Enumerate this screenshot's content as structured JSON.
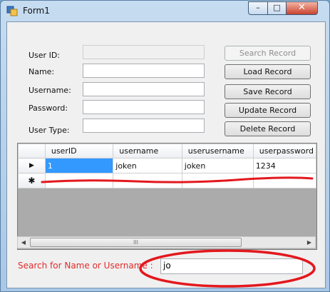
{
  "window": {
    "title": "Form1",
    "controls": {
      "minimize": "–",
      "maximize": "□",
      "close": "✕"
    }
  },
  "form": {
    "fields": [
      {
        "label": "User ID:",
        "value": "",
        "enabled": false
      },
      {
        "label": "Name:",
        "value": ""
      },
      {
        "label": "Username:",
        "value": ""
      },
      {
        "label": "Password:",
        "value": ""
      },
      {
        "label": "User Type:",
        "value": ""
      }
    ],
    "buttons": {
      "search": "Search Record",
      "load": "Load Record",
      "save": "Save Record",
      "update": "Update Record",
      "delete": "Delete Record"
    }
  },
  "grid": {
    "columns": [
      "userID",
      "username",
      "userusername",
      "userpassword"
    ],
    "rows": [
      {
        "indicator": "▶",
        "cells": [
          "1",
          "joken",
          "joken",
          "1234"
        ]
      },
      {
        "indicator": "✱",
        "cells": [
          "",
          "",
          "",
          ""
        ]
      }
    ],
    "scrollbar": {
      "left_arrow": "◀",
      "right_arrow": "▶",
      "thumb_grip": "III"
    }
  },
  "search": {
    "label": "Search for Name or Username :",
    "value": "jo"
  },
  "colors": {
    "annotation_red": "#e3181e",
    "selection": "#3399ff"
  }
}
